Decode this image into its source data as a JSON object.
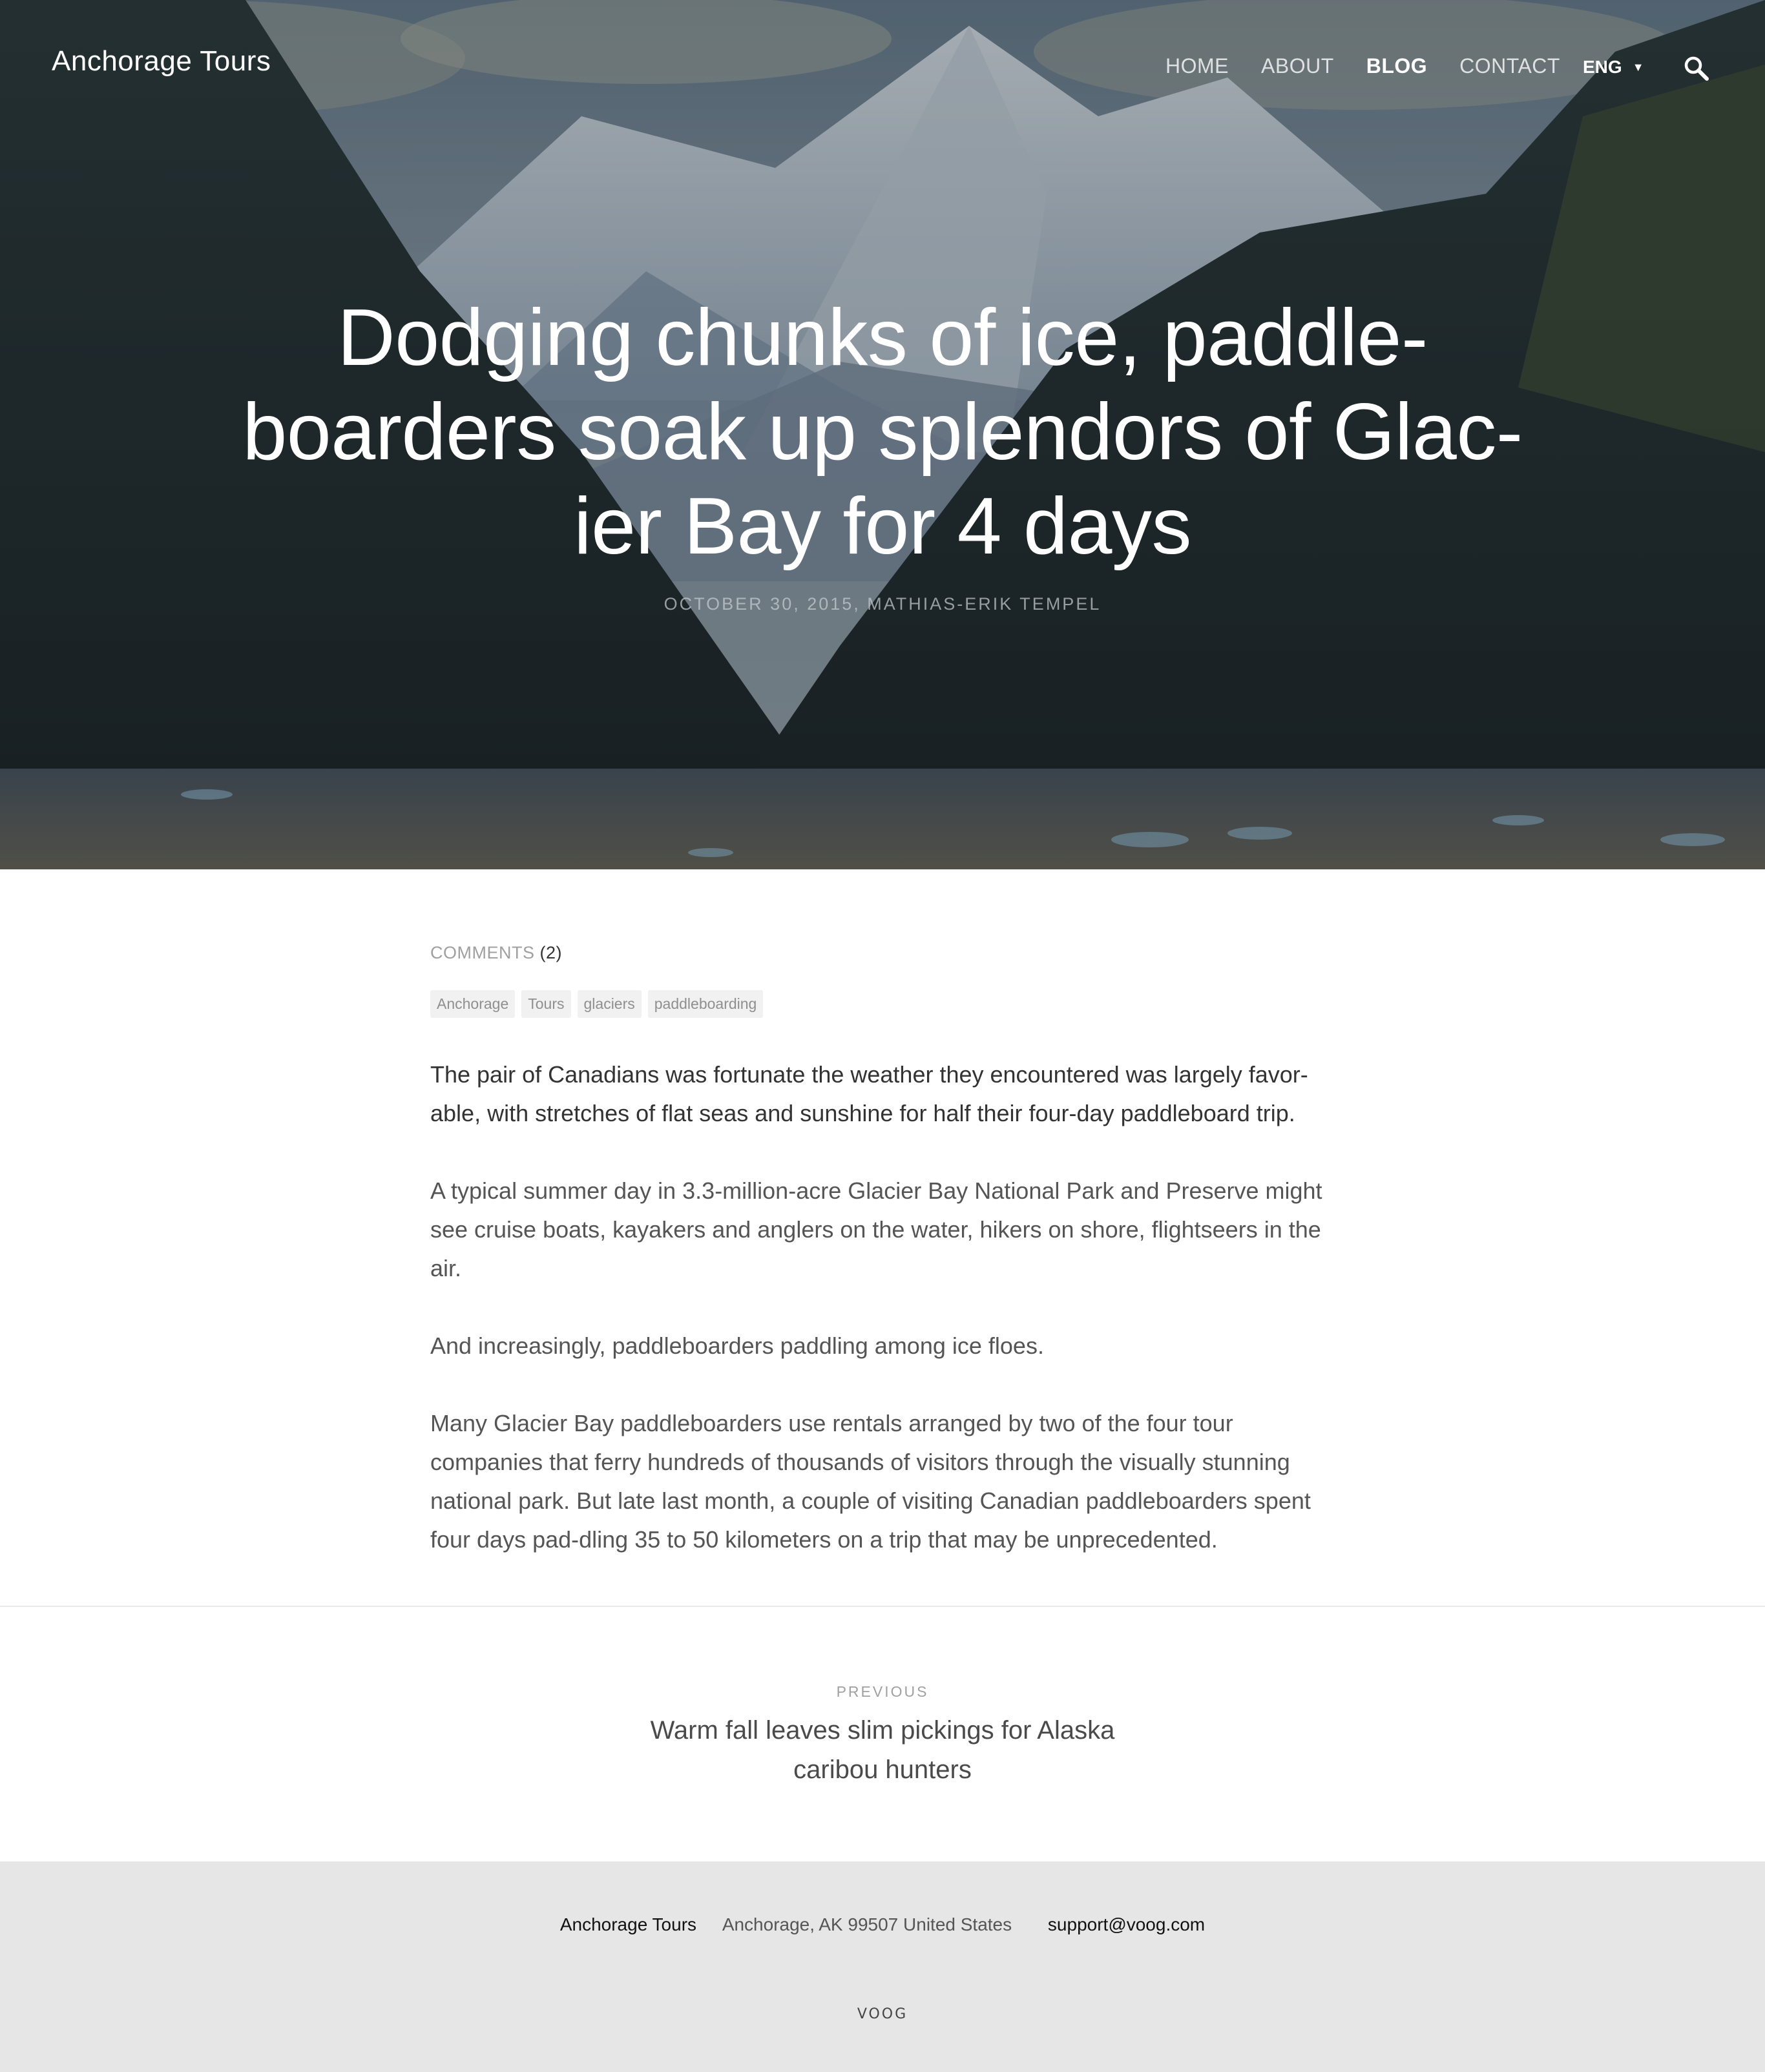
{
  "header": {
    "site_title": "Anchorage Tours",
    "nav": [
      {
        "label": "HOME",
        "active": false
      },
      {
        "label": "ABOUT",
        "active": false
      },
      {
        "label": "BLOG",
        "active": true
      },
      {
        "label": "CONTACT",
        "active": false
      }
    ],
    "language": "ENG",
    "search_icon": "search-icon"
  },
  "hero": {
    "title": "Dodging chunks of ice, paddle-boarders soak up splendors of Glac-ier Bay for 4 days",
    "meta": "OCTOBER 30, 2015, MATHIAS-ERIK TEMPEL"
  },
  "article": {
    "comments_label": "COMMENTS",
    "comments_count": "(2)",
    "tags": [
      "Anchorage",
      "Tours",
      "glaciers",
      "paddleboarding"
    ],
    "paragraphs": [
      "The pair of Canadians was fortunate the weather they encountered was largely favor-able, with stretches of flat seas and sunshine for half their four-day paddleboard trip.",
      "A typical summer day in 3.3-million-acre Glacier Bay National Park and Preserve might see cruise boats, kayakers and anglers on the water, hikers on shore, flightseers in the air.",
      "And increasingly, paddleboarders paddling among ice floes.",
      "Many Glacier Bay paddleboarders use rentals arranged by two of the four tour companies that ferry hundreds of thousands of visitors through the visually stunning national park. But late last month, a couple of visiting Canadian paddleboarders spent four days pad-dling 35 to 50 kilometers on a trip that may be unprecedented."
    ]
  },
  "pagination": {
    "previous_label": "PREVIOUS",
    "previous_title": "Warm fall leaves slim pickings for Alaska caribou hunters"
  },
  "footer": {
    "company": "Anchorage Tours",
    "address": "Anchorage, AK 99507 United States",
    "email": "support@voog.com",
    "logo": "VOOG"
  }
}
